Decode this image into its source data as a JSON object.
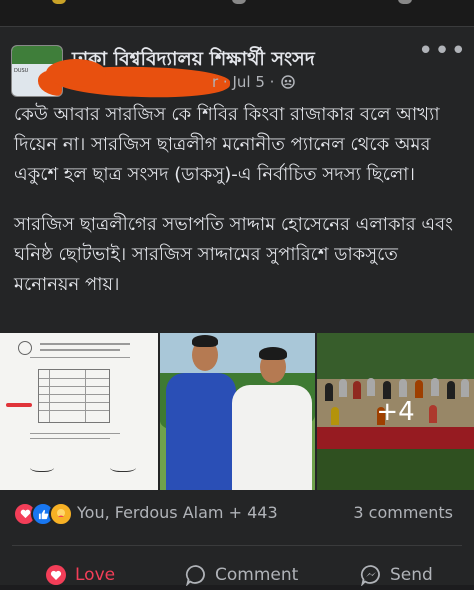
{
  "post": {
    "group_name": "ঢাকা বিশ্ববিদ্যালয় শিক্ষার্থী সংসদ",
    "meta_tail": "r · Jul 5 ·",
    "more_label": "•••",
    "paragraphs": [
      "কেউ আবার সারজিস কে শিবির কিংবা রাজাকার বলে আখ্যা দিয়েন না। সারজিস ছাত্রলীগ মনোনীত প্যানেল থেকে অমর একুশে হল ছাত্র সংসদ (ডাকসু)-এ নির্বাচিত সদস্য ছিলো।",
      "সারজিস ছাত্রলীগের সভাপতি সাদ্দাম হোসেনের এলাকার এবং ঘনিষ্ঠ ছোটভাই। সারজিস সাদ্দামের সুপারিশে ডাকসুতে মনোনয়ন পায়।"
    ],
    "extra_photos_label": "+4"
  },
  "reactions": {
    "names": "You, Ferdous Alam + 443",
    "comments": "3 comments"
  },
  "actions": {
    "love": "Love",
    "comment": "Comment",
    "send": "Send"
  },
  "colors": {
    "love_red": "#f33e58",
    "like_blue": "#1877f2",
    "care_yellow": "#f7b125",
    "card_bg": "#242526"
  }
}
